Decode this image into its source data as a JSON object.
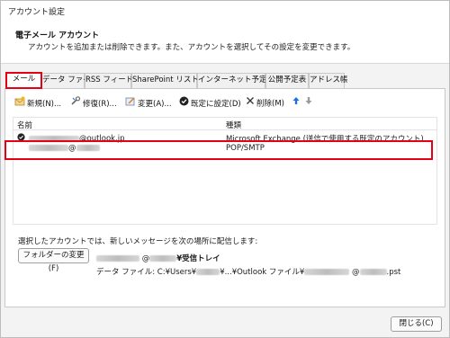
{
  "window": {
    "title": "アカウント設定"
  },
  "header": {
    "title": "電子メール アカウント",
    "description": "アカウントを追加または削除できます。また、アカウントを選択してその設定を変更できます。"
  },
  "tabs": [
    {
      "label": "メール",
      "active": true
    },
    {
      "label": "データ ファイル"
    },
    {
      "label": "RSS フィード"
    },
    {
      "label": "SharePoint リスト"
    },
    {
      "label": "インターネット予定表"
    },
    {
      "label": "公開予定表"
    },
    {
      "label": "アドレス帳"
    }
  ],
  "toolbar": {
    "new_label": "新規(N)...",
    "repair_label": "修復(R)...",
    "change_label": "変更(A)...",
    "default_label": "既定に設定(D)",
    "delete_label": "削除(M)"
  },
  "accounts": {
    "col_name": "名前",
    "col_type": "種類",
    "rows": [
      {
        "name_suffix": "@outlook.jp",
        "type": "Microsoft Exchange (送信で使用する既定のアカウント)",
        "default": true
      },
      {
        "name_suffix": "@",
        "type": "POP/SMTP",
        "default": false
      }
    ]
  },
  "delivery": {
    "label": "選択したアカウントでは、新しいメッセージを次の場所に配信します:",
    "change_folder_label": "フォルダーの変更(F)",
    "path_at": "@",
    "path_folder": "¥受信トレイ",
    "data_file_prefix": "データ ファイル:  C:¥Users¥",
    "data_file_mid": "¥...¥Outlook ファイル¥",
    "data_file_at": "@",
    "data_file_ext": ".pst"
  },
  "footer": {
    "close_label": "閉じる(C)"
  },
  "colors": {
    "highlight": "#e60012",
    "accent_blue": "#1e6fd9"
  }
}
